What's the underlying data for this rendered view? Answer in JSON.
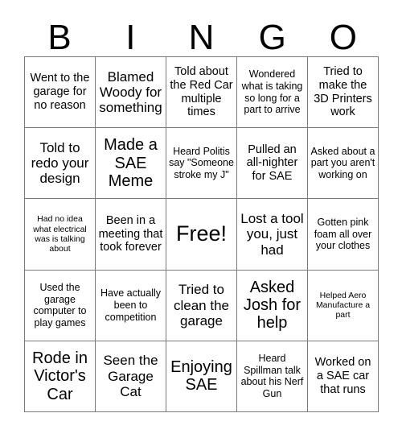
{
  "card": {
    "title_letters": [
      "B",
      "I",
      "N",
      "G",
      "O"
    ],
    "rows": [
      [
        {
          "text": "Went to the garage for no reason",
          "size": "m"
        },
        {
          "text": "Blamed Woody for something",
          "size": "l"
        },
        {
          "text": "Told about the Red Car multiple times",
          "size": "m"
        },
        {
          "text": "Wondered what is taking so long for a part to arrive",
          "size": "s"
        },
        {
          "text": "Tried to make the 3D Printers work",
          "size": "m"
        }
      ],
      [
        {
          "text": "Told to redo your design",
          "size": "l"
        },
        {
          "text": "Made a SAE Meme",
          "size": "xl"
        },
        {
          "text": "Heard Politis say \"Someone stroke my J\"",
          "size": "s"
        },
        {
          "text": "Pulled an all-nighter for SAE",
          "size": "m"
        },
        {
          "text": "Asked about a part you aren't working on",
          "size": "s"
        }
      ],
      [
        {
          "text": "Had no idea what electrical was is talking about",
          "size": "xs"
        },
        {
          "text": "Been in a meeting that took forever",
          "size": "m"
        },
        {
          "text": "Free!",
          "size": "free"
        },
        {
          "text": "Lost a tool you, just had",
          "size": "l"
        },
        {
          "text": "Gotten pink foam all over your clothes",
          "size": "s"
        }
      ],
      [
        {
          "text": "Used the garage computer to play games",
          "size": "s"
        },
        {
          "text": "Have actually been to competition",
          "size": "s"
        },
        {
          "text": "Tried to clean the garage",
          "size": "l"
        },
        {
          "text": "Asked Josh for help",
          "size": "xl"
        },
        {
          "text": "Helped Aero Manufacture a part",
          "size": "xs"
        }
      ],
      [
        {
          "text": "Rode in Victor's Car",
          "size": "xl"
        },
        {
          "text": "Seen the Garage Cat",
          "size": "l"
        },
        {
          "text": "Enjoying SAE",
          "size": "xl"
        },
        {
          "text": "Heard Spillman talk about his Nerf Gun",
          "size": "s"
        },
        {
          "text": "Worked on a SAE car that runs",
          "size": "m"
        }
      ]
    ]
  }
}
